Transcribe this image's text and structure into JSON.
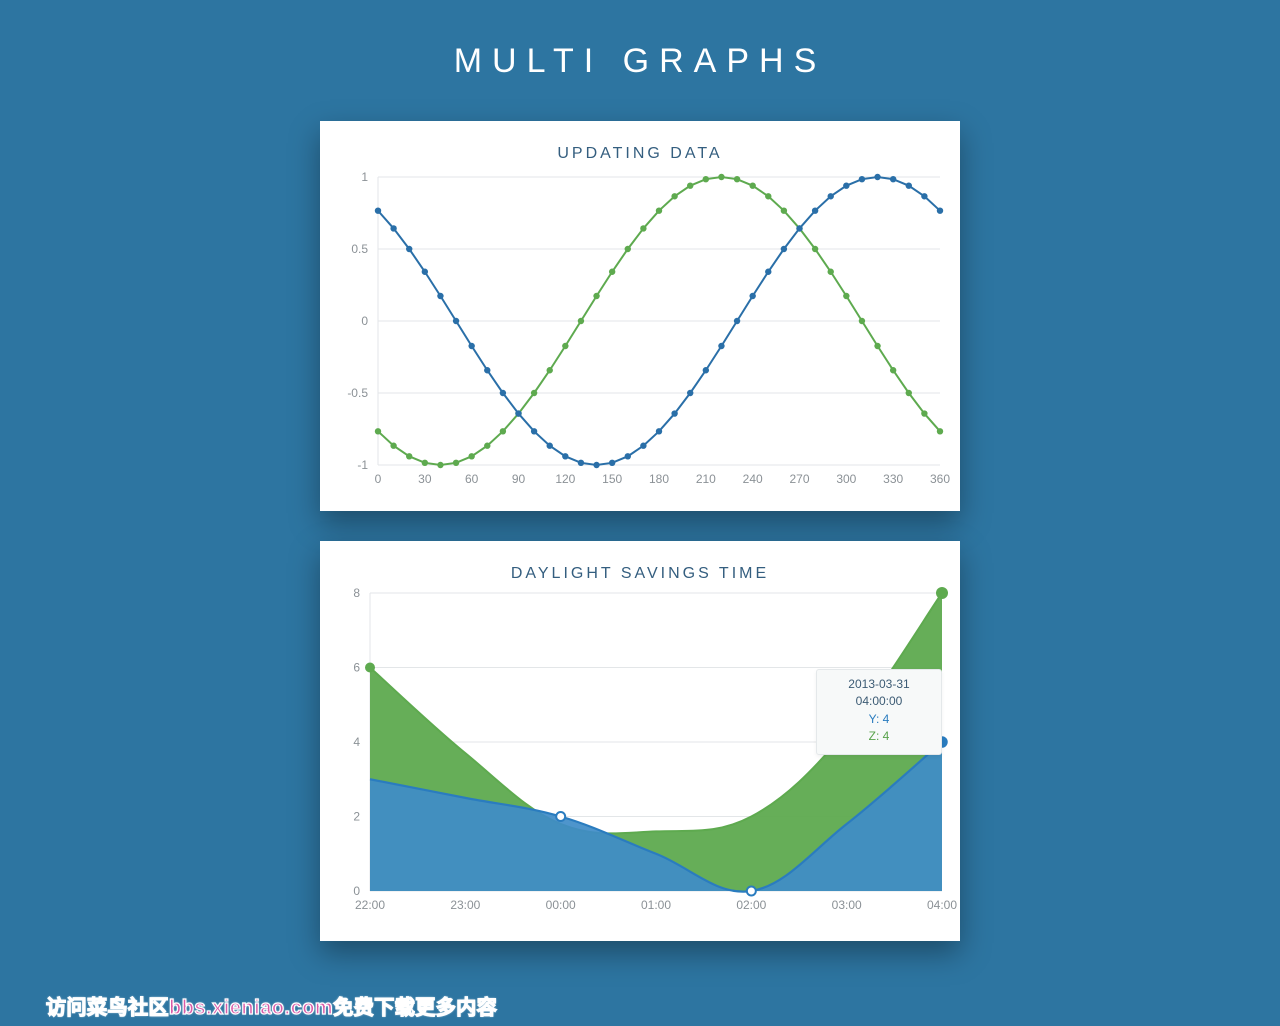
{
  "page_title": "MULTI GRAPHS",
  "chart_data": [
    {
      "id": "updating",
      "type": "line",
      "title": "UPDATING DATA",
      "xlabel": "",
      "ylabel": "",
      "x_step": 10,
      "x_tick_step": 30,
      "xlim": [
        0,
        360
      ],
      "ylim": [
        -1,
        1
      ],
      "y_ticks": [
        -1,
        -0.5,
        0,
        0.5,
        1
      ],
      "phase_green_deg": 230,
      "phase_blue_deg": 130,
      "colors": {
        "green": "#5eaa4f",
        "blue": "#2a6fa8"
      },
      "series": [
        {
          "name": "green",
          "formula": "sin(x + phase_green)"
        },
        {
          "name": "blue",
          "formula": "sin(x + phase_blue)"
        }
      ]
    },
    {
      "id": "dst",
      "type": "area",
      "title": "DAYLIGHT SAVINGS TIME",
      "xlabel": "",
      "ylabel": "",
      "ylim": [
        0,
        8
      ],
      "y_ticks": [
        0,
        2,
        4,
        6,
        8
      ],
      "x_categories": [
        "22:00",
        "23:00",
        "00:00",
        "01:00",
        "02:00",
        "03:00",
        "04:00"
      ],
      "series": [
        {
          "name": "Z",
          "color": "#5eaa4f",
          "fill": "#5eaa4f",
          "values": [
            6,
            3.7,
            1.8,
            1.6,
            2,
            4.3,
            8
          ]
        },
        {
          "name": "Y",
          "color": "#2a7cbf",
          "fill": "#3f8cc8",
          "values": [
            3,
            2.5,
            2,
            1,
            0,
            1.8,
            4
          ]
        }
      ],
      "hover_index": 6,
      "hover_markers_index": [
        2,
        4
      ],
      "tooltip": {
        "date": "2013-03-31",
        "time": "04:00:00",
        "y_label": "Y: 4",
        "z_label": "Z: 4"
      }
    }
  ],
  "watermark": "访问菜鸟社区bbs.xieniao.com免费下载更多内容"
}
